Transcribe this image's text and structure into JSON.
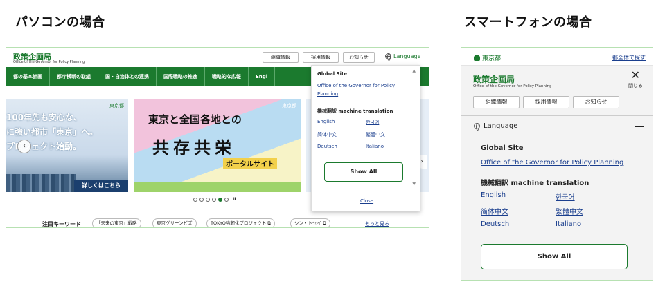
{
  "headings": {
    "pc": "パソコンの場合",
    "sp": "スマートフォンの場合"
  },
  "pc": {
    "logo_title": "政策企画局",
    "logo_subtitle": "Office of the Governor for Policy Planning",
    "top_buttons": [
      "組織情報",
      "採用情報",
      "お知らせ"
    ],
    "language_label": "Language",
    "nav": [
      "都の基本計画",
      "都庁横断の取組",
      "国・自治体との連携",
      "国際戦略の推進",
      "戦略的な広報",
      "Engl"
    ],
    "banner1": {
      "line1": "100年先も安心な、",
      "line2": "に強い都市「東京」へ。",
      "line3": "プロジェクト始動。",
      "link": "詳しくはこちら",
      "logo": "東京都"
    },
    "banner2": {
      "line1": "東京と全国各地との",
      "line2": "共存共栄",
      "line3": "ポータルサイト",
      "logo": "東京都"
    },
    "carousel_prev": "‹",
    "carousel_next": "›",
    "keywords_label": "注目キーワード",
    "keywords": [
      "「未来の東京」戦略",
      "東京グリーンビズ",
      "TOKYO強靭化プロジェクト ⧉",
      "シン・トセイ ⧉"
    ],
    "more_link": "もっと見る",
    "pause": "II",
    "dropdown": {
      "global_heading": "Global Site",
      "global_link_line1": "Office of the Governor for Policy",
      "global_link_line2": "Planning",
      "mt_heading": "機械翻訳 machine translation",
      "languages": [
        "English",
        "한국어",
        "简体中文",
        "繁體中文",
        "Deutsch",
        "Italiano"
      ],
      "show_all": "Show All",
      "close": "Close"
    }
  },
  "sp": {
    "logo": "東京都",
    "search_link": "都全体で探す",
    "title": "政策企画局",
    "subtitle": "Office of the Governor for Policy Planning",
    "close_label": "閉じる",
    "buttons": [
      "組織情報",
      "採用情報",
      "お知らせ"
    ],
    "language_label": "Language",
    "global_heading": "Global Site",
    "global_link": "Office of the Governor for Policy Planning",
    "mt_heading": "機械翻訳 machine translation",
    "languages": [
      "English",
      "한국어",
      "简体中文",
      "繁體中文",
      "Deutsch",
      "Italiano"
    ],
    "show_all": "Show All"
  },
  "colors": {
    "brand_green": "#1b7a2e",
    "link_blue": "#1b3f8e",
    "frame_border": "#b7e1b2"
  }
}
